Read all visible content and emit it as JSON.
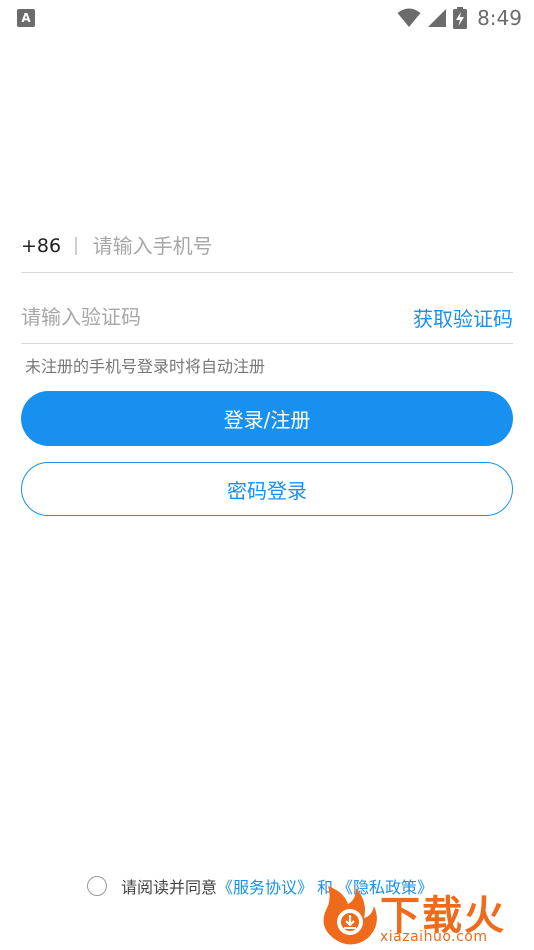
{
  "status_bar": {
    "app_icon_letter": "A",
    "time": "8:49"
  },
  "login_form": {
    "country_code": "+86",
    "phone_placeholder": "请输入手机号",
    "code_placeholder": "请输入验证码",
    "get_code_label": "获取验证码",
    "hint": "未注册的手机号登录时将自动注册",
    "login_register_label": "登录/注册",
    "password_login_label": "密码登录"
  },
  "agreement": {
    "prefix": "请阅读并同意",
    "service_link": "《服务协议》",
    "separator": "和",
    "privacy_link": "《隐私政策》"
  },
  "watermark": {
    "brand": "下载火",
    "domain": "xiazaihuo.com"
  },
  "colors": {
    "accent": "#1890f0",
    "watermark": "#f06a1c"
  }
}
